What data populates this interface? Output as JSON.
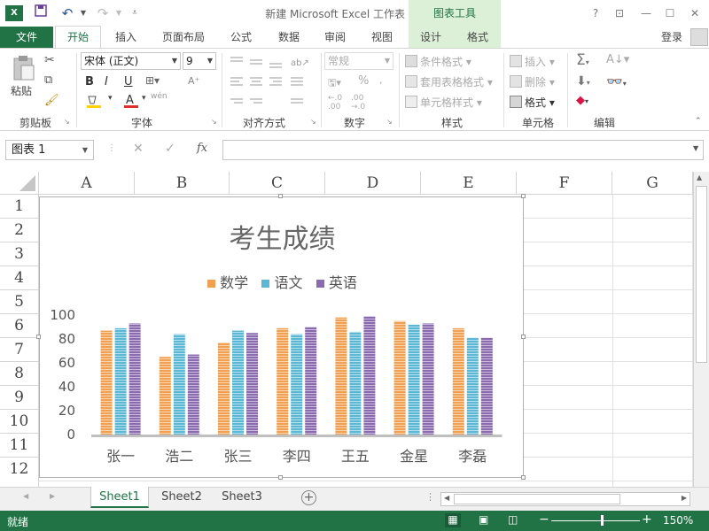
{
  "window": {
    "title": "新建 Microsoft Excel 工作表 - Excel",
    "context_tools": "图表工具",
    "login": "登录"
  },
  "tabs": {
    "file": "文件",
    "home": "开始",
    "insert": "插入",
    "page_layout": "页面布局",
    "formulas": "公式",
    "data": "数据",
    "review": "审阅",
    "view": "视图",
    "design": "设计",
    "format": "格式"
  },
  "ribbon": {
    "clipboard": {
      "paste": "粘贴",
      "group": "剪贴板"
    },
    "font": {
      "name": "宋体 (正文)",
      "size": "9",
      "group": "字体",
      "bold": "B",
      "italic": "I",
      "underline": "U",
      "wen": "wén"
    },
    "alignment": {
      "group": "对齐方式"
    },
    "number": {
      "format": "常规",
      "percent": "%",
      "group": "数字"
    },
    "styles": {
      "conditional": "条件格式",
      "table": "套用表格格式",
      "cell_styles": "单元格样式",
      "group": "样式"
    },
    "cells": {
      "insert": "插入",
      "delete": "删除",
      "format": "格式",
      "group": "单元格"
    },
    "editing": {
      "group": "编辑"
    }
  },
  "formula_bar": {
    "name_box": "图表 1",
    "fx": "fx",
    "value": ""
  },
  "columns": [
    "A",
    "B",
    "C",
    "D",
    "E",
    "F",
    "G"
  ],
  "rows": [
    "1",
    "2",
    "3",
    "4",
    "5",
    "6",
    "7",
    "8",
    "9",
    "10",
    "11",
    "12"
  ],
  "chart_data": {
    "type": "bar",
    "title": "考生成绩",
    "categories": [
      "张一",
      "浩二",
      "张三",
      "李四",
      "王五",
      "金星",
      "李磊"
    ],
    "series": [
      {
        "name": "数学",
        "values": [
          87,
          65,
          77,
          89,
          98,
          95,
          89
        ],
        "color": "#f0a050"
      },
      {
        "name": "语文",
        "values": [
          89,
          84,
          87,
          84,
          86,
          92,
          81
        ],
        "color": "#5bb8d4"
      },
      {
        "name": "英语",
        "values": [
          93,
          67,
          85,
          90,
          99,
          93,
          81
        ],
        "color": "#8b6bb0"
      }
    ],
    "yticks": [
      "0",
      "20",
      "40",
      "60",
      "80",
      "100"
    ],
    "ylim": [
      0,
      100
    ],
    "legend": "top",
    "grid": false
  },
  "sheets": [
    "Sheet1",
    "Sheet2",
    "Sheet3"
  ],
  "status": {
    "ready": "就绪",
    "zoom": "150%",
    "zoom_minus": "−",
    "zoom_plus": "+"
  }
}
